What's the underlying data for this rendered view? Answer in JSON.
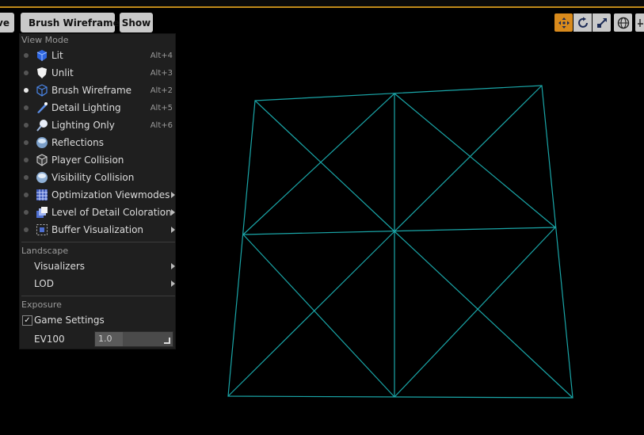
{
  "toolbar": {
    "prev_label": "ve",
    "view_mode_button": "Brush Wireframe",
    "show_button": "Show"
  },
  "menu": {
    "view_mode_header": "View Mode",
    "view_modes": [
      {
        "label": "Lit",
        "shortcut": "Alt+4",
        "icon": "lit-cube-icon",
        "selected": false
      },
      {
        "label": "Unlit",
        "shortcut": "Alt+3",
        "icon": "unlit-shield-icon",
        "selected": false
      },
      {
        "label": "Brush Wireframe",
        "shortcut": "Alt+2",
        "icon": "wireframe-cube-icon",
        "selected": true
      },
      {
        "label": "Detail Lighting",
        "shortcut": "Alt+5",
        "icon": "detail-lighting-icon",
        "selected": false
      },
      {
        "label": "Lighting Only",
        "shortcut": "Alt+6",
        "icon": "lighting-only-icon",
        "selected": false
      },
      {
        "label": "Reflections",
        "shortcut": "",
        "icon": "reflections-sphere-icon",
        "selected": false
      },
      {
        "label": "Player Collision",
        "shortcut": "",
        "icon": "player-collision-icon",
        "selected": false
      },
      {
        "label": "Visibility Collision",
        "shortcut": "",
        "icon": "visibility-collision-icon",
        "selected": false
      },
      {
        "label": "Optimization Viewmodes",
        "shortcut": "",
        "icon": "optimization-grid-icon",
        "selected": false,
        "submenu": true
      },
      {
        "label": "Level of Detail Coloration",
        "shortcut": "",
        "icon": "lod-coloration-icon",
        "selected": false,
        "submenu": true
      },
      {
        "label": "Buffer Visualization",
        "shortcut": "",
        "icon": "buffer-visualization-icon",
        "selected": false,
        "submenu": true
      }
    ],
    "landscape_header": "Landscape",
    "landscape_items": [
      {
        "label": "Visualizers",
        "submenu": true
      },
      {
        "label": "LOD",
        "submenu": true
      }
    ],
    "exposure_header": "Exposure",
    "game_settings_label": "Game Settings",
    "game_settings_checked": true,
    "ev100_label": "EV100",
    "ev100_value": "1.0"
  },
  "colors": {
    "wireframe": "#1aa6a8",
    "transform_active": "#d88a1c"
  }
}
